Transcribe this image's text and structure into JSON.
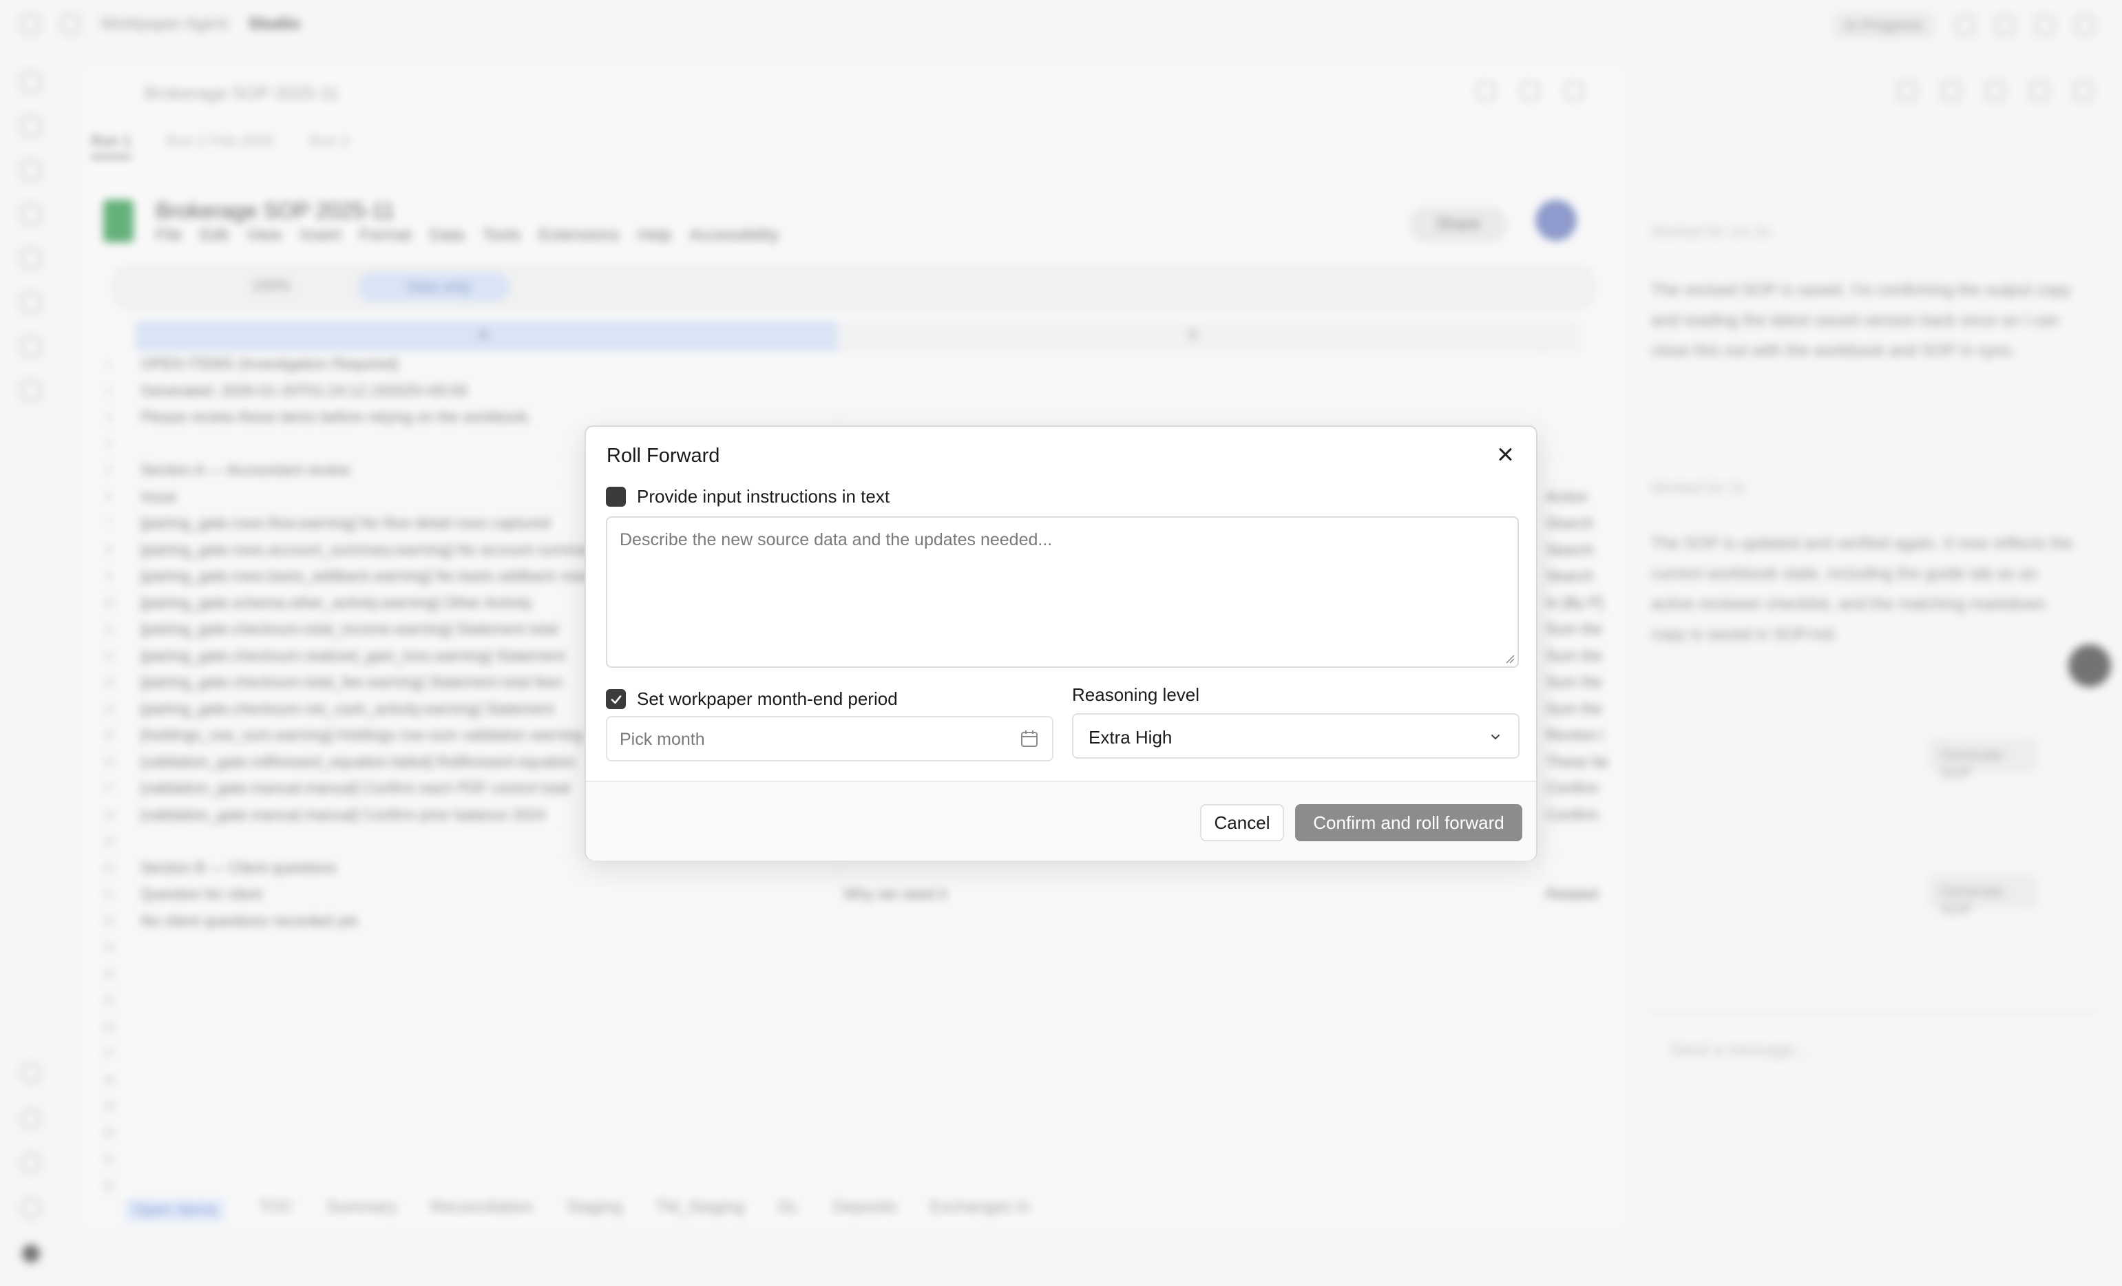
{
  "background": {
    "breadcrumb": [
      "Workpaper Agent",
      "Studio"
    ],
    "top_badge": "In Progress",
    "doc_title": "Brokerage SOP 2025-11",
    "run_tabs": [
      {
        "label": "Run 1"
      },
      {
        "label": "Run 2   Feb 2025"
      },
      {
        "label": "Run 3"
      }
    ],
    "sheet": {
      "name": "Brokerage SOP 2025-11",
      "menu": [
        "File",
        "Edit",
        "View",
        "Insert",
        "Format",
        "Data",
        "Tools",
        "Extensions",
        "Help",
        "Accessibility"
      ],
      "share_label": "Share",
      "zoom": "100%",
      "mode": "View only",
      "col_headers": [
        "A",
        "B"
      ],
      "rows": [
        {
          "n": "1",
          "a": "OPEN ITEMS (Investigation Required)",
          "b": "",
          "c": ""
        },
        {
          "n": "2",
          "a": "Generated: 2026-01-20T01:24:12.192025+00:00",
          "b": "",
          "c": ""
        },
        {
          "n": "3",
          "a": "Please review these items before relying on the workbook.",
          "b": "",
          "c": ""
        },
        {
          "n": "4",
          "a": "",
          "b": "",
          "c": ""
        },
        {
          "n": "5",
          "a": "Section A — Accountant review",
          "b": "",
          "c": ""
        },
        {
          "n": "6",
          "a": "Issue",
          "b": "",
          "c": "Action"
        },
        {
          "n": "7",
          "a": "[pairing_gate.rows.flow.warning] No flow detail rows captured",
          "b": "",
          "c": "Search th"
        },
        {
          "n": "8",
          "a": "[pairing_gate.rows.account_summary.warning] No account summary",
          "b": "",
          "c": "Search th"
        },
        {
          "n": "9",
          "a": "[pairing_gate.rows.basis_addback.warning] No basis addback rows",
          "b": "",
          "c": "Search th"
        },
        {
          "n": "10",
          "a": "[pairing_gate.schema.other_activity.warning] Other Activity",
          "b": "",
          "c": "In [By P]"
        },
        {
          "n": "11",
          "a": "[pairing_gate.checksum.total_income.warning] Statement total",
          "b": "",
          "c": "Sum the"
        },
        {
          "n": "12",
          "a": "[pairing_gate.checksum.realized_gain_loss.warning] Statement",
          "b": "",
          "c": "Sum the"
        },
        {
          "n": "13",
          "a": "[pairing_gate.checksum.total_fee.warning] Statement total fees",
          "b": "",
          "c": "Sum the"
        },
        {
          "n": "14",
          "a": "[pairing_gate.checksum.net_cash_activity.warning] Statement",
          "b": "",
          "c": "Sum the"
        },
        {
          "n": "15",
          "a": "[holdings_row_sum.warning] Holdings row-sum validation warning",
          "b": "",
          "c": "Review t"
        },
        {
          "n": "16",
          "a": "[validation_gate.rollforward_equation.failed] Rollforward equation",
          "b": "",
          "c": "These fai"
        },
        {
          "n": "17",
          "a": "[validation_gate.manual.manual] Confirm each PDF control total",
          "b": "",
          "c": "Confirm"
        },
        {
          "n": "18",
          "a": "[validation_gate.manual.manual] Confirm prior balance 2024",
          "b": "",
          "c": "Confirm"
        },
        {
          "n": "19",
          "a": "",
          "b": "",
          "c": ""
        },
        {
          "n": "20",
          "a": "Section B — Client questions",
          "b": "",
          "c": ""
        },
        {
          "n": "21",
          "a": "Question for client",
          "b": "Why we need it",
          "c": "Related"
        },
        {
          "n": "22",
          "a": "No client questions recorded yet.",
          "b": "",
          "c": ""
        },
        {
          "n": "23",
          "a": "",
          "b": "",
          "c": ""
        },
        {
          "n": "24",
          "a": "",
          "b": "",
          "c": ""
        },
        {
          "n": "25",
          "a": "",
          "b": "",
          "c": ""
        },
        {
          "n": "26",
          "a": "",
          "b": "",
          "c": ""
        },
        {
          "n": "27",
          "a": "",
          "b": "",
          "c": ""
        },
        {
          "n": "28",
          "a": "",
          "b": "",
          "c": ""
        },
        {
          "n": "29",
          "a": "",
          "b": "",
          "c": ""
        },
        {
          "n": "30",
          "a": "",
          "b": "",
          "c": ""
        },
        {
          "n": "31",
          "a": "",
          "b": "",
          "c": ""
        },
        {
          "n": "32",
          "a": "",
          "b": "",
          "c": ""
        }
      ],
      "tabs": [
        "Open Items",
        "TOC",
        "Summary",
        "Reconciliation",
        "Staging",
        "TM_Staging",
        "GL",
        "Deposits",
        "Exchanges In"
      ]
    },
    "chat": {
      "worked1": "Worked for 1m 2s",
      "para1": "The revised SOP is saved. I'm confirming the output copy and reading the latest saved version back once so I can close this out with the workbook and SOP in sync.",
      "worked2": "Worked for 2s",
      "para2": "The SOP is updated and verified again. It now reflects the current workbook state, including the guide tab as an active reviewer checklist, and the matching markdown copy is saved in SOP.md.",
      "gen_label": "Generate SOP",
      "input_placeholder": "Send a message..."
    }
  },
  "modal": {
    "title": "Roll Forward",
    "text_instructions": {
      "label": "Provide input instructions in text",
      "checked": false
    },
    "textarea_placeholder": "Describe the new source data and the updates needed...",
    "period": {
      "label": "Set workpaper month-end period",
      "checked": true,
      "placeholder": "Pick month"
    },
    "reasoning": {
      "label": "Reasoning level",
      "value": "Extra High"
    },
    "cancel_label": "Cancel",
    "confirm_label": "Confirm and roll forward"
  },
  "colors": {
    "checkbox": "#3b3b3b",
    "confirm_disabled": "#8c8c8c",
    "sheets_green": "#1e8e3e"
  }
}
